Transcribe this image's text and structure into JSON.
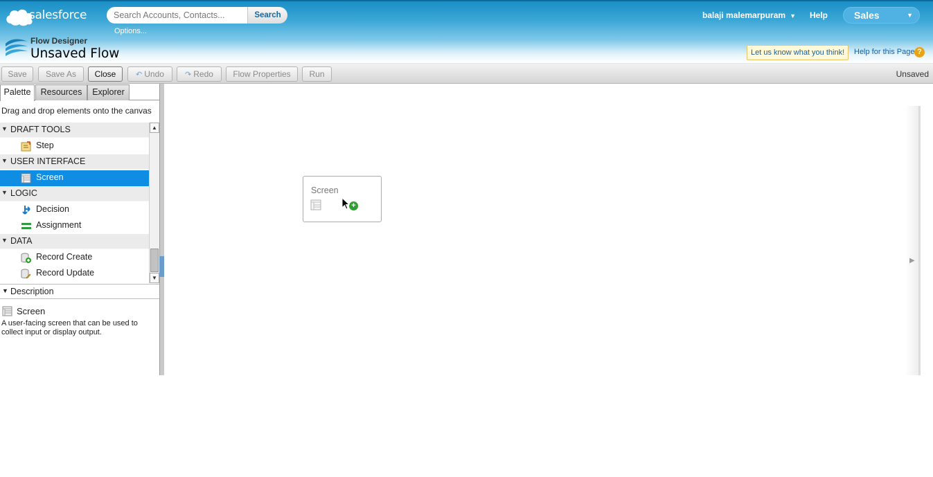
{
  "header": {
    "brand": "salesforce",
    "search_placeholder": "Search Accounts, Contacts...",
    "search_button": "Search",
    "search_options": "Options...",
    "user_name": "balaji malemarpuram",
    "help": "Help",
    "app_name": "Sales",
    "module_label": "Flow Designer",
    "page_title": "Unsaved Flow",
    "feedback_link": "Let us know what you think!",
    "page_help": "Help for this Page",
    "help_icon": "?"
  },
  "toolbar": {
    "save": "Save",
    "save_as": "Save As",
    "close": "Close",
    "undo": "Undo",
    "redo": "Redo",
    "flow_properties": "Flow Properties",
    "run": "Run",
    "status": "Unsaved"
  },
  "left_panel": {
    "tabs": [
      "Palette",
      "Resources",
      "Explorer"
    ],
    "selected_tab": "Palette",
    "hint": "Drag and drop elements onto the canvas",
    "categories": [
      {
        "label": "DRAFT TOOLS",
        "items": [
          {
            "label": "Step",
            "icon": "step-icon"
          }
        ]
      },
      {
        "label": "USER INTERFACE",
        "items": [
          {
            "label": "Screen",
            "icon": "screen-icon",
            "selected": true
          }
        ]
      },
      {
        "label": "LOGIC",
        "items": [
          {
            "label": "Decision",
            "icon": "decision-icon"
          },
          {
            "label": "Assignment",
            "icon": "assignment-icon"
          }
        ]
      },
      {
        "label": "DATA",
        "items": [
          {
            "label": "Record Create",
            "icon": "record-create-icon"
          },
          {
            "label": "Record Update",
            "icon": "record-update-icon"
          }
        ]
      }
    ],
    "description": {
      "header": "Description",
      "title": "Screen",
      "text": "A user-facing screen that can be used to collect input or display output."
    }
  },
  "canvas": {
    "node": {
      "label": "Screen",
      "icon": "screen-icon",
      "add_icon": "+"
    }
  },
  "colors": {
    "header_blue": "#1b8fc6",
    "selection_blue": "#0f8de2",
    "add_green": "#2ea02e",
    "help_orange": "#e8a317"
  }
}
